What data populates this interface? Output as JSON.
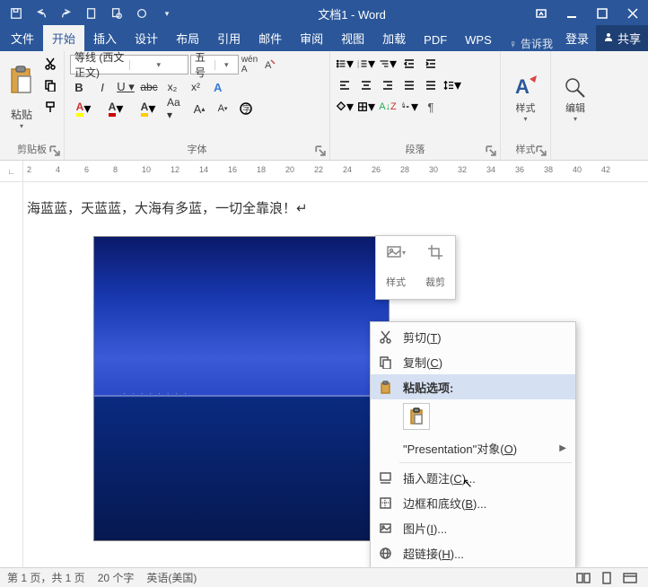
{
  "title": "文档1 - Word",
  "tabs": {
    "file": "文件",
    "home": "开始",
    "insert": "插入",
    "design": "设计",
    "layout": "布局",
    "references": "引用",
    "mailings": "邮件",
    "review": "审阅",
    "view": "视图",
    "addins": "加载",
    "pdf": "PDF",
    "wps": "WPS"
  },
  "tell_me": "告诉我",
  "login": "登录",
  "share": "共享",
  "ribbon": {
    "clipboard": {
      "paste": "粘贴",
      "label": "剪贴板"
    },
    "font": {
      "name": "等线 (西文正文)",
      "size": "五号",
      "label": "字体"
    },
    "paragraph": {
      "label": "段落"
    },
    "styles": {
      "btn": "样式",
      "label": "样式"
    },
    "editing": {
      "btn": "编辑"
    }
  },
  "ruler": [
    2,
    4,
    6,
    8,
    10,
    12,
    14,
    16,
    18,
    20,
    22,
    24,
    26,
    28,
    30,
    32,
    34,
    36,
    38,
    40,
    42
  ],
  "body_text": "海蓝蓝，天蓝蓝，大海有多蓝，一切全靠浪！↵",
  "mini_toolbar": {
    "styles": "样式",
    "crop": "裁剪"
  },
  "context_menu": {
    "cut": "剪切(T)",
    "copy": "复制(C)",
    "paste_options_label": "粘贴选项:",
    "presentation_obj": "\"Presentation\"对象(O)",
    "insert_caption": "插入题注(C)...",
    "borders_shading": "边框和底纹(B)...",
    "picture": "图片(I)...",
    "hyperlink": "超链接(H)..."
  },
  "statusbar": {
    "page": "第 1 页，共 1 页",
    "words": "20 个字",
    "lang": "英语(美国)"
  }
}
